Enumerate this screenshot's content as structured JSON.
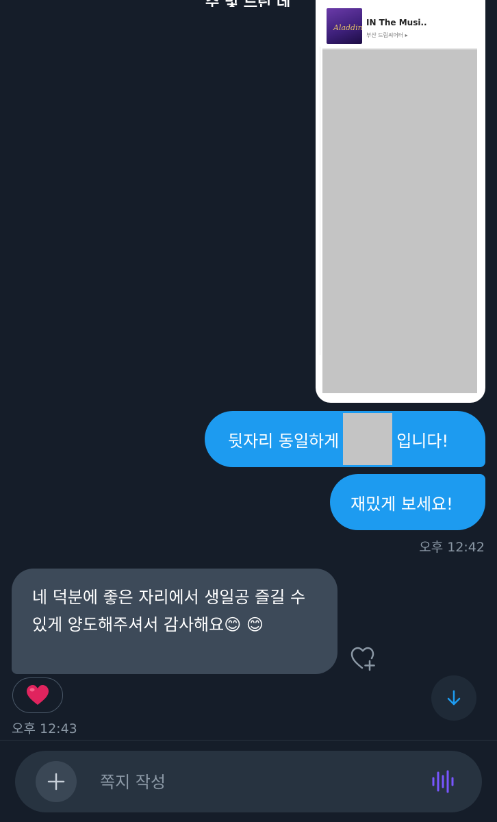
{
  "header": {
    "title": "수 및 드린 데"
  },
  "shared_image": {
    "show_title": "IN The Musi..",
    "show_venue": "부산 드림씨어터 ▸",
    "poster_text": "Aladdin"
  },
  "messages_out": [
    {
      "before": "뒷자리 동일하게",
      "after": "입니다!"
    },
    {
      "text": "재밌게 보세요!"
    }
  ],
  "time_out": "오후 12:42",
  "message_in": {
    "text": "네 덕분에 좋은 자리에서 생일공 즐길 수있게 양도해주셔서 감사해요😊 😊"
  },
  "reaction": "❤️",
  "time_in": "오후 12:43",
  "composer": {
    "placeholder": "쪽지 작성"
  },
  "colors": {
    "background": "#151d29",
    "outgoing_bubble": "#1d9bf0",
    "incoming_bubble": "#3d4a59",
    "accent_voice": "#7856ff",
    "reaction_heart": "#e0245e"
  }
}
